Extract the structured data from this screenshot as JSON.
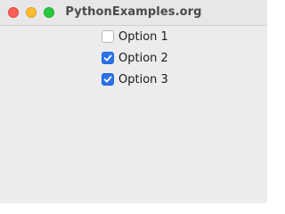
{
  "window": {
    "title": "PythonExamples.org"
  },
  "checkboxes": [
    {
      "label": "Option 1",
      "checked": false
    },
    {
      "label": "Option 2",
      "checked": true
    },
    {
      "label": "Option 3",
      "checked": true
    }
  ]
}
